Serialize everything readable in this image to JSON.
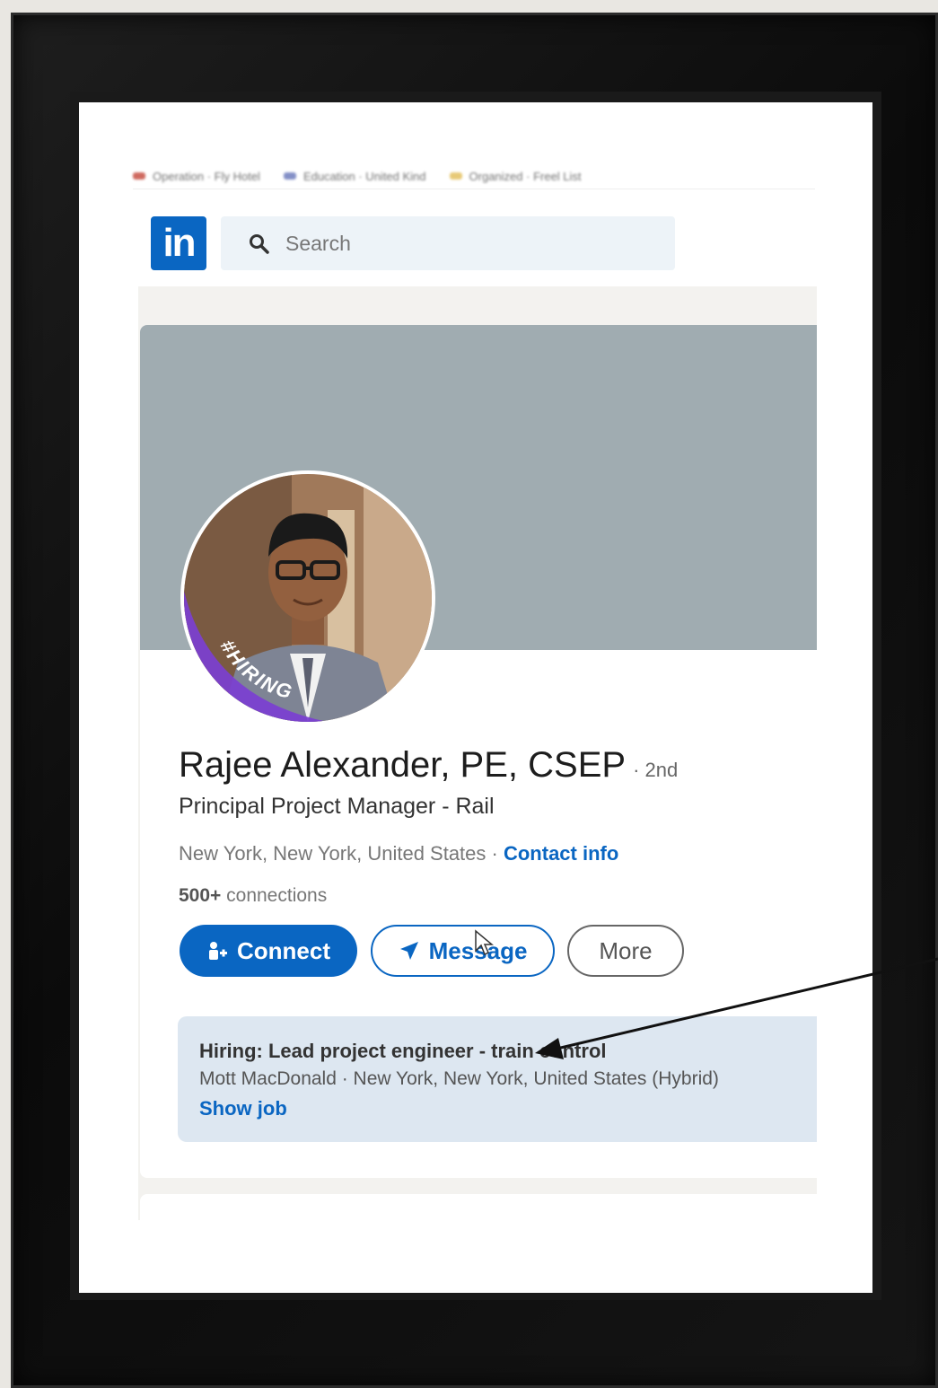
{
  "bookmarks": [
    {
      "label": "Operation · Fly Hotel",
      "color": "#c0392b"
    },
    {
      "label": "Education · United Kind",
      "color": "#5b6bb5"
    },
    {
      "label": "Organized · Freel List",
      "color": "#e0b84a"
    }
  ],
  "header": {
    "logo_text": "in",
    "search_placeholder": "Search"
  },
  "profile": {
    "avatar_badge": "#HIRING",
    "name": "Rajee Alexander, PE, CSEP",
    "degree": "· 2nd",
    "headline": "Principal Project Manager - Rail",
    "location": "New York, New York, United States",
    "separator": " · ",
    "contact_label": "Contact info",
    "connections_count": "500+",
    "connections_label": " connections"
  },
  "actions": {
    "connect_label": "Connect",
    "message_label": "Message",
    "more_label": "More"
  },
  "hiring": {
    "title": "Hiring: Lead project engineer - train control",
    "meta": "Mott MacDonald · New York, New York, United States (Hybrid)",
    "link": "Show job"
  },
  "colors": {
    "brand": "#0a66c2",
    "hiring_ring": "#7b3fd1",
    "cover": "#a0acb1"
  }
}
